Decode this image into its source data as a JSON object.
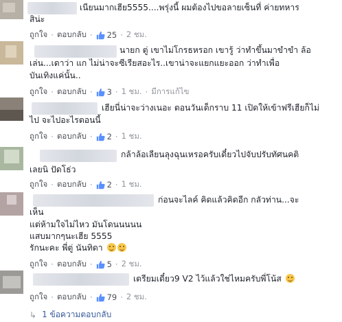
{
  "comments": [
    {
      "lines": [
        "เนียนมากเฮีย5555....พรุ่งนี้ ผมต้องไปขอลายเซ็นที่ ค่ายทหาร",
        "สิน่ะ"
      ],
      "reply_label": "ถูกใจ",
      "reply_btn": "ตอบกลับ",
      "likes": "25",
      "time": "2 ชม.",
      "avatar_color": "#b7b0a6",
      "emojis": 0
    },
    {
      "lines": [
        "นายก ตู่ เขาไม่โกรธหรอก เขารู้ ว่าทำขึ้นมาขำขำ ล้อ",
        "เล่น...เดาว่า แก ไม่น่าจะซีเรียสอะไร..เขาน่าจะแยกแยะออก ว่าทำเพื่อ",
        "บันเทิงแค่นั้น.."
      ],
      "reply_label": "ถูกใจ",
      "reply_btn": "ตอบกลับ",
      "likes": "3",
      "time": "1 ชม.",
      "edited": "มีการแก้ไข",
      "avatar_color": "#c9b89a",
      "emojis": 0
    },
    {
      "lines": [
        "เฮียนี่น่าจะว่างเนอะ ตอนวันเด็กราบ 11 เปิดให้เข้าฟรีเฮียก็ไม่",
        "ไป จะไปอะไรตอนนี้"
      ],
      "reply_label": "ถูกใจ",
      "reply_btn": "ตอบกลับ",
      "likes": "2",
      "time": "1 ชม.",
      "avatar_color": "#8a8278",
      "emojis": 0
    },
    {
      "lines": [
        "กล้าล้อเลียนลุงฉุนเหรอครับเดี๋ยวไปจับปรับทัศนคติ",
        "เลยนิ ปัดโธ่ว"
      ],
      "reply_label": "ถูกใจ",
      "reply_btn": "ตอบกลับ",
      "likes": "2",
      "time": "1 ชม.",
      "avatar_color": "#a9b7a0",
      "emojis": 0
    },
    {
      "lines": [
        "ก่อนจะไลค์ คิดแล้วคิดอีก กลัวท่าน...จะ",
        "เห็น",
        "แต่ห้ามใจไม่ไหว มันโดนนนนน",
        "แสบมากๆนะเฮีย 5555",
        "รักนะคะ พี่ตู่ นันทิดา"
      ],
      "reply_label": "ถูกใจ",
      "reply_btn": "ตอบกลับ",
      "likes": "5",
      "time": "2 ชม.",
      "avatar_color": "#b3a3a3",
      "emojis": 2
    },
    {
      "lines": [
        "เตรียมเดี๋ยว9 V2 ไว้แล้วใช่ไหมครับพี่โน้ส"
      ],
      "reply_label": "ถูกใจ",
      "reply_btn": "ตอบกลับ",
      "likes": "79",
      "time": "2 ชม.",
      "avatar_color": "#9c9a96",
      "emojis": 1
    }
  ],
  "replies_label": "1 ข้อความตอบกลับ",
  "colors": {
    "link": "#365899",
    "meta": "#90949c",
    "text": "#1d2129",
    "like_blue": "#5890ff"
  }
}
